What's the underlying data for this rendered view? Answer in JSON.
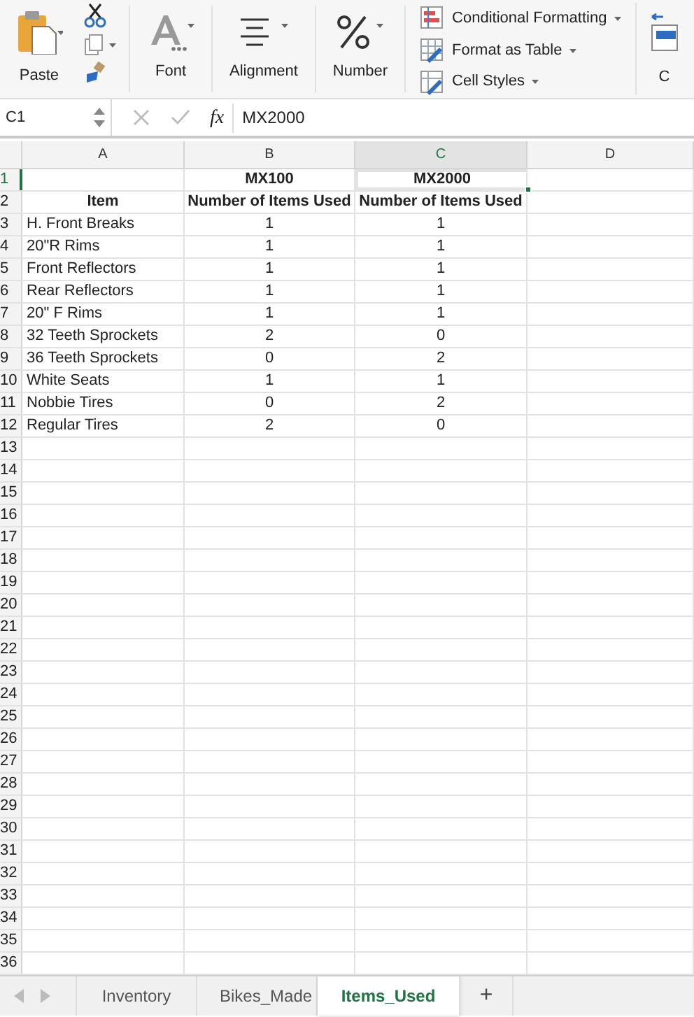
{
  "ribbon": {
    "paste": "Paste",
    "groups": [
      {
        "kind": "font",
        "label": "Font"
      },
      {
        "kind": "alignment",
        "label": "Alignment"
      },
      {
        "kind": "number",
        "label": "Number"
      }
    ],
    "styles": [
      {
        "kind": "conditional",
        "label": "Conditional Formatting"
      },
      {
        "kind": "table",
        "label": "Format as Table"
      },
      {
        "kind": "cellstyles",
        "label": "Cell Styles"
      }
    ],
    "cut_off_label": "C"
  },
  "formula_bar": {
    "name_box": "C1",
    "fx": "fx",
    "value": "MX2000"
  },
  "columns": [
    {
      "label": "A",
      "selected": false
    },
    {
      "label": "B",
      "selected": false
    },
    {
      "label": "C",
      "selected": true
    },
    {
      "label": "D",
      "selected": false
    }
  ],
  "rows": [
    {
      "number": "1",
      "selected": true,
      "kind": "header",
      "cells": [
        null,
        "MX100",
        "MX2000"
      ]
    },
    {
      "number": "2",
      "selected": false,
      "kind": "header",
      "cells": [
        "Item",
        "Number of Items Used",
        "Number of Items Used"
      ]
    },
    {
      "number": "3",
      "selected": false,
      "kind": "data",
      "cells": [
        "H. Front Breaks",
        "1",
        "1"
      ]
    },
    {
      "number": "4",
      "selected": false,
      "kind": "data",
      "cells": [
        "20\"R Rims",
        "1",
        "1"
      ]
    },
    {
      "number": "5",
      "selected": false,
      "kind": "data",
      "cells": [
        "Front Reflectors",
        "1",
        "1"
      ]
    },
    {
      "number": "6",
      "selected": false,
      "kind": "data",
      "cells": [
        "Rear Reflectors",
        "1",
        "1"
      ]
    },
    {
      "number": "7",
      "selected": false,
      "kind": "data",
      "cells": [
        "20\" F Rims",
        "1",
        "1"
      ]
    },
    {
      "number": "8",
      "selected": false,
      "kind": "data",
      "cells": [
        "32 Teeth Sprockets",
        "2",
        "0"
      ]
    },
    {
      "number": "9",
      "selected": false,
      "kind": "data",
      "cells": [
        "36 Teeth Sprockets",
        "0",
        "2"
      ]
    },
    {
      "number": "10",
      "selected": false,
      "kind": "data",
      "cells": [
        "White Seats",
        "1",
        "1"
      ]
    },
    {
      "number": "11",
      "selected": false,
      "kind": "data",
      "cells": [
        "Nobbie Tires",
        "0",
        "2"
      ]
    },
    {
      "number": "12",
      "selected": false,
      "kind": "data",
      "cells": [
        "Regular Tires",
        "2",
        "0"
      ]
    },
    {
      "number": "13",
      "selected": false
    },
    {
      "number": "14",
      "selected": false
    },
    {
      "number": "15",
      "selected": false
    },
    {
      "number": "16",
      "selected": false
    },
    {
      "number": "17",
      "selected": false
    },
    {
      "number": "18",
      "selected": false
    },
    {
      "number": "19",
      "selected": false
    },
    {
      "number": "20",
      "selected": false
    },
    {
      "number": "21",
      "selected": false
    },
    {
      "number": "22",
      "selected": false
    },
    {
      "number": "23",
      "selected": false
    },
    {
      "number": "24",
      "selected": false
    },
    {
      "number": "25",
      "selected": false
    },
    {
      "number": "26",
      "selected": false
    },
    {
      "number": "27",
      "selected": false
    },
    {
      "number": "28",
      "selected": false
    },
    {
      "number": "29",
      "selected": false
    },
    {
      "number": "30",
      "selected": false
    },
    {
      "number": "31",
      "selected": false
    },
    {
      "number": "32",
      "selected": false
    },
    {
      "number": "33",
      "selected": false
    },
    {
      "number": "34",
      "selected": false
    },
    {
      "number": "35",
      "selected": false
    },
    {
      "number": "36",
      "selected": false
    }
  ],
  "sheet_tabs": [
    {
      "label": "Inventory",
      "selected": false
    },
    {
      "label": "Bikes_Made",
      "selected": false
    },
    {
      "label": "Items_Used",
      "selected": true
    }
  ],
  "add_sheet": "+"
}
